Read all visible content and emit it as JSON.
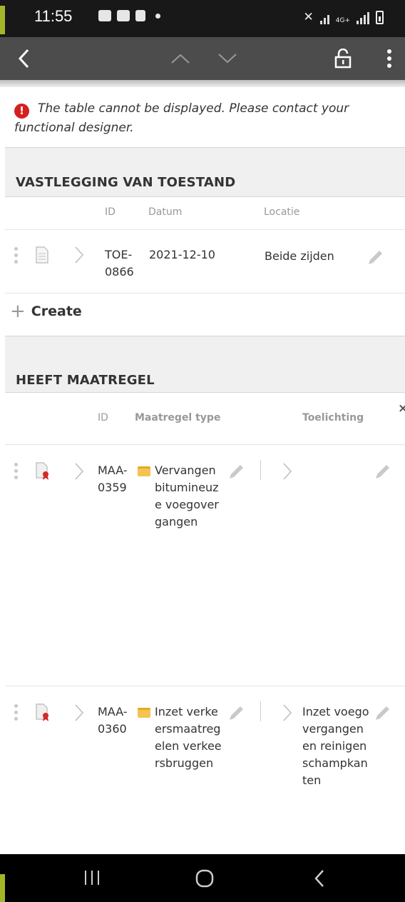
{
  "status_bar": {
    "time": "11:55",
    "network": "4G+"
  },
  "toolbar": {
    "icons": [
      "back-arrow-icon",
      "chevron-up-icon",
      "chevron-down-icon",
      "unlock-icon",
      "more-vertical-icon"
    ]
  },
  "error": {
    "message": "The table cannot be displayed. Please contact your functional designer."
  },
  "section1": {
    "title": "VASTLEGGING VAN TOESTAND",
    "columns": {
      "id": "ID",
      "datum": "Datum",
      "locatie": "Locatie"
    },
    "row": {
      "id": "TOE-0866",
      "datum": "2021-12-10",
      "locatie": "Beide zijden"
    },
    "create_label": "Create"
  },
  "section2": {
    "title": "HEEFT MAATREGEL",
    "columns": {
      "id": "ID",
      "type": "Maatregel type",
      "toelichting": "Toelichting"
    },
    "rows": [
      {
        "id": "MAA-0359",
        "type": "Vervangen bitumineuze voegovergangen",
        "toelichting": ""
      },
      {
        "id": "MAA-0360",
        "type": "Inzet verkeersmaatregelen verkeersbruggen",
        "toelichting": "Inzet voegovergangen en reinigen schampkanten"
      }
    ]
  },
  "colors": {
    "toolbar": "#4c4c4c",
    "error": "#d61f1f",
    "accent_lime": "#a4b52a",
    "section_bg": "#f0f0f0"
  }
}
